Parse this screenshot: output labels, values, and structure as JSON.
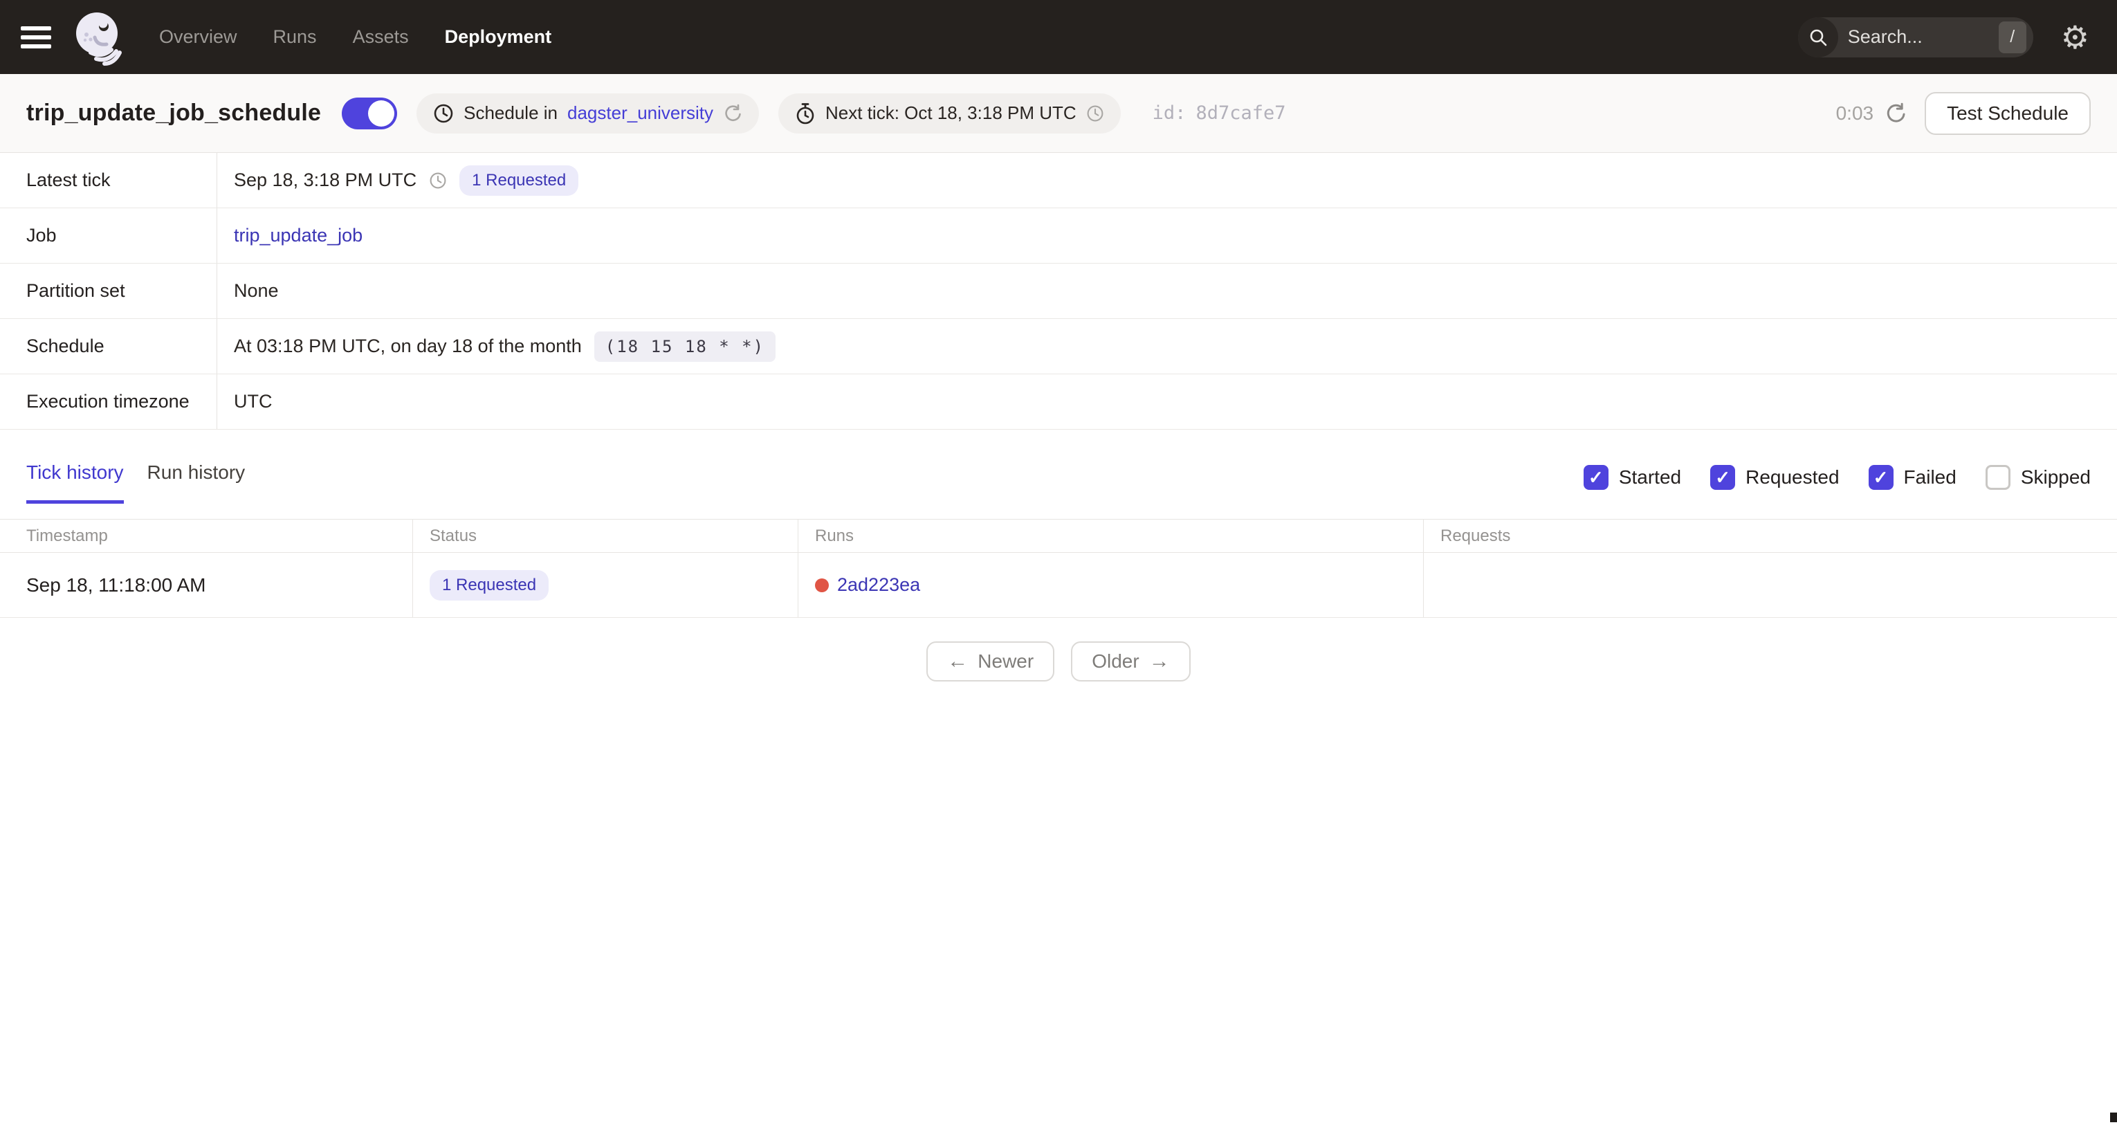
{
  "nav": {
    "items": [
      {
        "label": "Overview",
        "active": false
      },
      {
        "label": "Runs",
        "active": false
      },
      {
        "label": "Assets",
        "active": false
      },
      {
        "label": "Deployment",
        "active": true
      }
    ],
    "search": {
      "placeholder": "Search...",
      "shortcut_key": "/"
    }
  },
  "icons": {
    "gear": "⚙",
    "checkmark": "✓",
    "arrow_left": "←",
    "arrow_right": "→"
  },
  "header": {
    "title": "trip_update_job_schedule",
    "toggle_state": "on",
    "schedule_pill": {
      "text": "Schedule in",
      "code_location_link": "dagster_university"
    },
    "next_tick_pill": {
      "text": "Next tick: Oct 18, 3:18 PM UTC"
    },
    "id_label": "id:",
    "id_value": "8d7cafe7",
    "countdown": "0:03",
    "test_schedule_button": "Test Schedule"
  },
  "details": {
    "rows": [
      {
        "label": "Latest tick",
        "value": "Sep 18, 3:18 PM UTC",
        "badge": "1 Requested"
      },
      {
        "label": "Job",
        "link": "trip_update_job"
      },
      {
        "label": "Partition set",
        "value": "None"
      },
      {
        "label": "Schedule",
        "value": "At 03:18 PM UTC, on day 18 of the month",
        "cron": "(18 15 18 * *)"
      },
      {
        "label": "Execution timezone",
        "value": "UTC"
      }
    ]
  },
  "tabs": [
    {
      "label": "Tick history",
      "active": true
    },
    {
      "label": "Run history",
      "active": false
    }
  ],
  "filters": [
    {
      "label": "Started",
      "checked": true
    },
    {
      "label": "Requested",
      "checked": true
    },
    {
      "label": "Failed",
      "checked": true
    },
    {
      "label": "Skipped",
      "checked": false
    }
  ],
  "tick_table": {
    "columns": [
      "Timestamp",
      "Status",
      "Runs",
      "Requests"
    ],
    "rows": [
      {
        "timestamp": "Sep 18, 11:18:00 AM",
        "status_badge": "1 Requested",
        "run_id": "2ad223ea",
        "requests": ""
      }
    ]
  },
  "pagination": {
    "newer_label": "Newer",
    "older_label": "Older"
  },
  "colors": {
    "accent": "#4F43DD",
    "link": "#3B35B4",
    "badge_bg": "#ECEBFA",
    "run_status_dot": "#E05545",
    "nav_bg": "#25211E"
  }
}
